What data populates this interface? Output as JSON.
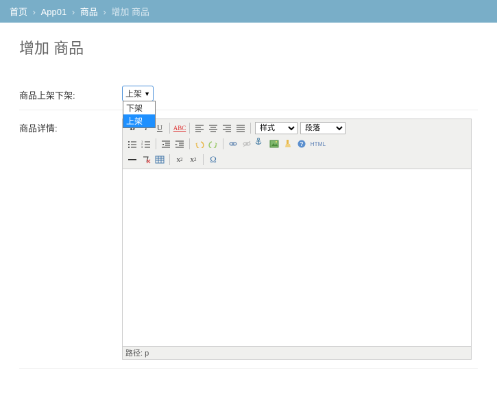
{
  "breadcrumb": {
    "home": "首页",
    "app": "App01",
    "model": "商品",
    "current": "增加 商品"
  },
  "title": "增加 商品",
  "fields": {
    "onshelf": {
      "label": "商品上架下架:",
      "selected": "上架",
      "options": [
        "下架",
        "上架"
      ],
      "highlight_index": 1
    },
    "detail": {
      "label": "商品详情:"
    }
  },
  "editor": {
    "style_select": "样式",
    "format_select": "段落",
    "status_label": "路径:",
    "status_path": "p",
    "buttons": {
      "bold": "B",
      "italic": "I",
      "underline": "U",
      "spellcheck": "ABC",
      "align_left": "align-left",
      "align_center": "align-center",
      "align_right": "align-right",
      "align_full": "align-full",
      "ul": "ul",
      "ol": "ol",
      "outdent": "outdent",
      "indent": "indent",
      "undo": "undo",
      "redo": "redo",
      "link": "link",
      "unlink": "unlink",
      "anchor": "anchor",
      "image": "image",
      "cleanup": "cleanup",
      "help": "help",
      "html": "HTML",
      "hr": "hr",
      "removeformat": "removeformat",
      "table": "table",
      "sub": "sub",
      "sup": "sup",
      "char": "char"
    }
  }
}
